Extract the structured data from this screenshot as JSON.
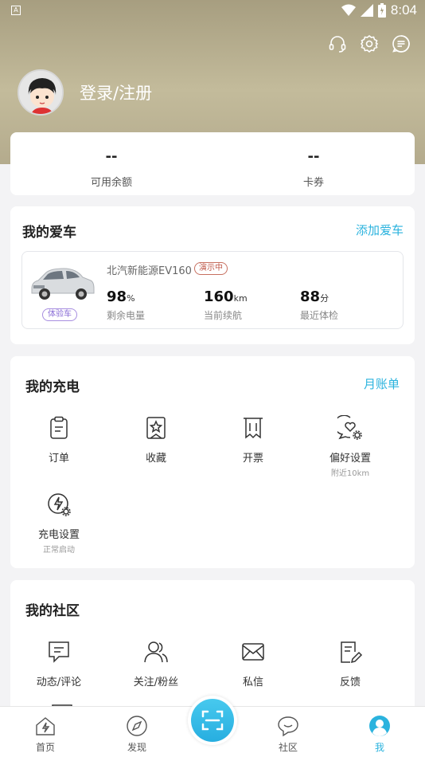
{
  "status_bar": {
    "time": "8:04",
    "left_icon": "A"
  },
  "header": {
    "login_label": "登录/注册",
    "icons": [
      "headset-icon",
      "gear-icon",
      "message-icon"
    ]
  },
  "balance": {
    "items": [
      {
        "value": "--",
        "label": "可用余额"
      },
      {
        "value": "--",
        "label": "卡券"
      }
    ]
  },
  "my_car": {
    "title": "我的爱车",
    "add_label": "添加爱车",
    "car": {
      "name": "北汽新能源EV160",
      "demo_badge": "演示中",
      "trial_badge": "体验车",
      "battery": {
        "value": "98",
        "unit": "%",
        "label": "剩余电量"
      },
      "range": {
        "value": "160",
        "unit": "km",
        "label": "当前续航"
      },
      "checkup": {
        "value": "88",
        "unit": "分",
        "label": "最近体检"
      }
    }
  },
  "charging": {
    "title": "我的充电",
    "link_label": "月账单",
    "items": [
      {
        "label": "订单",
        "sub": ""
      },
      {
        "label": "收藏",
        "sub": ""
      },
      {
        "label": "开票",
        "sub": ""
      },
      {
        "label": "偏好设置",
        "sub": "附近10km"
      },
      {
        "label": "充电设置",
        "sub": "正常启动"
      }
    ]
  },
  "community": {
    "title": "我的社区",
    "items": [
      {
        "label": "动态/评论"
      },
      {
        "label": "关注/粉丝"
      },
      {
        "label": "私信"
      },
      {
        "label": "反馈"
      }
    ]
  },
  "tabbar": {
    "tabs": [
      {
        "label": "首页"
      },
      {
        "label": "发现"
      },
      {
        "label": "社区"
      },
      {
        "label": "我"
      }
    ],
    "accent": "#2bb3de"
  }
}
